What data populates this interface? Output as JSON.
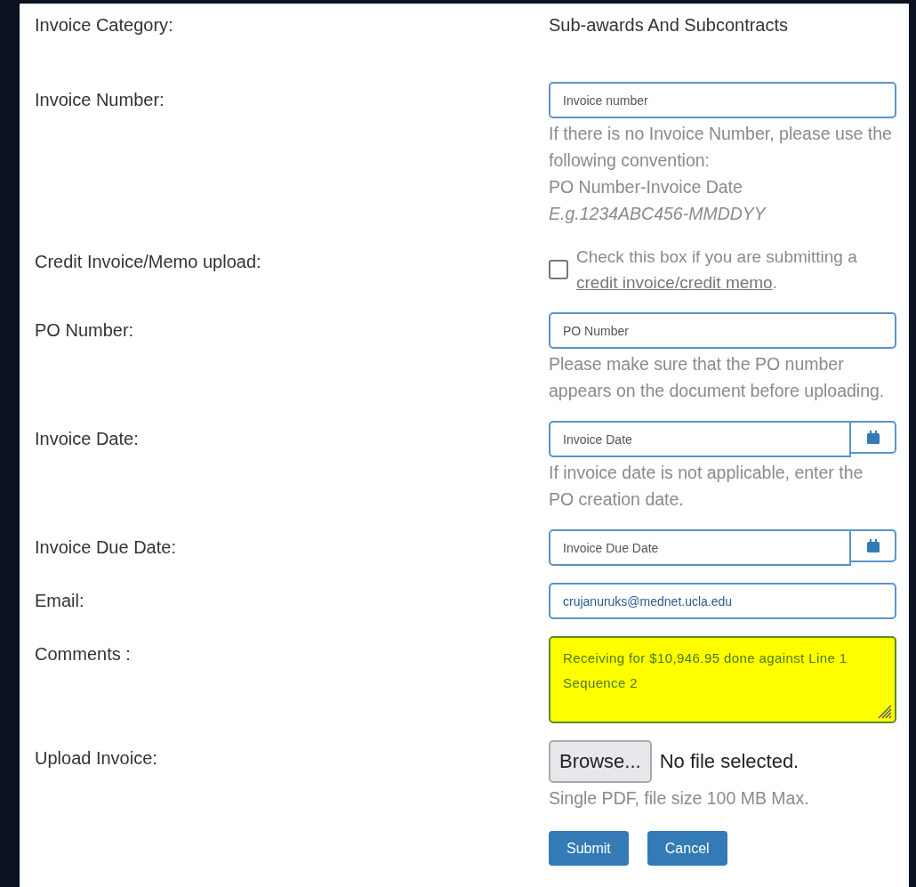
{
  "form": {
    "rows": [
      {
        "kind": "text",
        "label": "Invoice Category:",
        "value": "Sub-awards And Subcontracts"
      },
      {
        "kind": "input",
        "label": "Invoice Number:",
        "placeholder": "Invoice number",
        "help": [
          {
            "text": "If there is no Invoice Number, please use the following convention:",
            "italic": false
          },
          {
            "text": "PO Number-Invoice Date",
            "italic": false
          },
          {
            "text": "E.g.1234ABC456-MMDDYY",
            "italic": true
          }
        ]
      },
      {
        "kind": "checkbox",
        "label": "Credit Invoice/Memo upload:",
        "checked": false,
        "text": "Check this box if you are submitting a",
        "link": "credit invoice/credit memo",
        "after": "."
      },
      {
        "kind": "input",
        "label": "PO Number:",
        "placeholder": "PO Number",
        "help": [
          {
            "text": "Please make sure that the PO number appears on the document before uploading.",
            "italic": false
          }
        ]
      },
      {
        "kind": "date",
        "label": "Invoice Date:",
        "placeholder": "Invoice Date",
        "help": [
          {
            "text": "If invoice date is not applicable, enter the PO creation date.",
            "italic": false
          }
        ]
      },
      {
        "kind": "date",
        "label": "Invoice Due Date:",
        "placeholder": "Invoice Due Date"
      },
      {
        "kind": "input",
        "label": "Email:",
        "value": "crujanuruks@mednet.ucla.edu"
      },
      {
        "kind": "textarea",
        "label": "Comments :",
        "value": "Receiving for $10,946.95 done against Line 1 Sequence 2"
      },
      {
        "kind": "file",
        "label": "Upload Invoice:",
        "button": "Browse...",
        "status": "No file selected.",
        "help": [
          {
            "text": "Single PDF, file size 100 MB Max.",
            "italic": false
          }
        ]
      }
    ],
    "buttons": [
      "Submit",
      "Cancel"
    ]
  }
}
